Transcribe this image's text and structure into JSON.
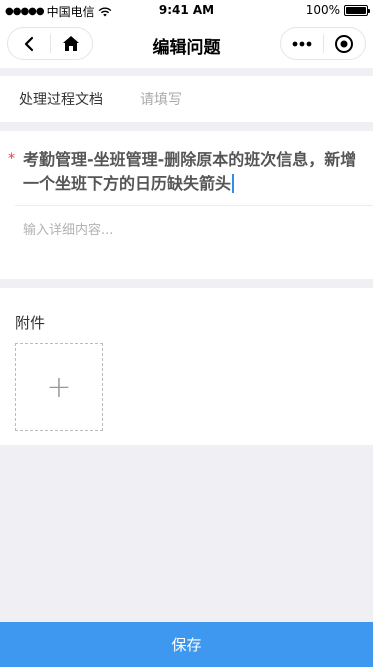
{
  "status_bar": {
    "signal": "●●●●●",
    "carrier": "中国电信",
    "time": "9:41 AM",
    "battery_text": "100%"
  },
  "nav": {
    "title": "编辑问题",
    "back_icon": "chevron-left-icon",
    "home_icon": "home-icon",
    "more_icon": "more-dots-icon",
    "close_icon": "target-icon"
  },
  "doc_field": {
    "label": "处理过程文档",
    "placeholder": "请填写"
  },
  "issue": {
    "required_mark": "*",
    "title": "考勤管理-坐班管理-删除原本的班次信息，新增一个坐班下方的日历缺失箭头",
    "detail_placeholder": "输入详细内容..."
  },
  "attachments": {
    "title": "附件",
    "add_symbol": "+"
  },
  "footer": {
    "save_label": "保存"
  },
  "colors": {
    "accent": "#3e98f0",
    "required": "#e64340",
    "background": "#efeff4"
  }
}
